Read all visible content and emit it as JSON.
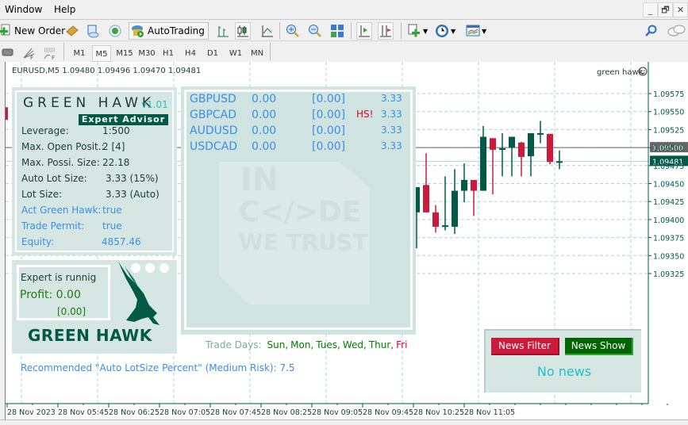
{
  "menu": {
    "items": [
      "Window",
      "Help"
    ]
  },
  "window_controls": {
    "minimize": "_",
    "restore": "🗗",
    "close": "✕"
  },
  "toolbar": {
    "new_order_label": "New Order",
    "autotrading_label": "AutoTrading",
    "icons": [
      "new-order-icon",
      "metaeditor-icon",
      "market-watch-icon",
      "signals-icon",
      "autotrading-icon",
      "bar-chart-icon",
      "candlestick-icon",
      "line-chart-icon",
      "zoom-in-icon",
      "zoom-out-icon",
      "tile-windows-icon",
      "chart-shift-icon",
      "autoscroll-icon",
      "indicators-icon",
      "periods-icon",
      "templates-icon",
      "search-icon",
      "chat-icon"
    ]
  },
  "timeframes": {
    "items": [
      "M1",
      "M5",
      "M15",
      "M30",
      "H1",
      "H4",
      "D1",
      "W1",
      "MN"
    ],
    "active": "M5"
  },
  "chart": {
    "symbol_info": "EURUSD,M5  1.09480 1.09496 1.09470 1.09481",
    "ea_label": "green hawk",
    "price_ticks": [
      "1.09575",
      "1.09550",
      "1.09525",
      "1.09500",
      "1.09475",
      "1.09450",
      "1.09425",
      "1.09400",
      "1.09375",
      "1.09350",
      "1.09325"
    ],
    "level_line_label": "1.09500",
    "bid_label": "1.09481",
    "time_ticks": [
      "28 Nov 2023",
      "28 Nov 05:45",
      "28 Nov 06:25",
      "28 Nov 07:05",
      "28 Nov 07:45",
      "28 Nov 08:25",
      "28 Nov 09:05",
      "28 Nov 09:45",
      "28 Nov 10:25",
      "28 Nov 11:05"
    ],
    "colors": {
      "bull": "#005a46",
      "bear": "#cc1a3c",
      "grid": "#a9d6df",
      "axis": "#005a46"
    },
    "candles": [
      {
        "o": 1.0941,
        "h": 1.0943,
        "l": 1.0936,
        "c": 1.09445
      },
      {
        "o": 1.09448,
        "h": 1.09492,
        "l": 1.09412,
        "c": 1.0941
      },
      {
        "o": 1.0941,
        "h": 1.0942,
        "l": 1.09382,
        "c": 1.0939
      },
      {
        "o": 1.0939,
        "h": 1.0946,
        "l": 1.09385,
        "c": 1.09392
      },
      {
        "o": 1.0939,
        "h": 1.0947,
        "l": 1.0938,
        "c": 1.0944
      },
      {
        "o": 1.0944,
        "h": 1.09478,
        "l": 1.09424,
        "c": 1.09455
      },
      {
        "o": 1.09455,
        "h": 1.09455,
        "l": 1.09405,
        "c": 1.0944
      },
      {
        "o": 1.0944,
        "h": 1.0953,
        "l": 1.0944,
        "c": 1.09515
      },
      {
        "o": 1.09513,
        "h": 1.0951,
        "l": 1.09435,
        "c": 1.09497
      },
      {
        "o": 1.09497,
        "h": 1.0952,
        "l": 1.0946,
        "c": 1.09499
      },
      {
        "o": 1.095,
        "h": 1.09508,
        "l": 1.0946,
        "c": 1.09515
      },
      {
        "o": 1.09507,
        "h": 1.09508,
        "l": 1.0946,
        "c": 1.09487
      },
      {
        "o": 1.09488,
        "h": 1.09508,
        "l": 1.0946,
        "c": 1.0952
      },
      {
        "o": 1.09519,
        "h": 1.09537,
        "l": 1.09506,
        "c": 1.0952
      },
      {
        "o": 1.09519,
        "h": 1.09519,
        "l": 1.09477,
        "c": 1.0948
      },
      {
        "o": 1.09481,
        "h": 1.09496,
        "l": 1.0947,
        "c": 1.09481
      }
    ]
  },
  "info_panel": {
    "title": "GREEN HAWK",
    "version": "v1.01",
    "subtitle": "Expert Advisor",
    "rows": [
      {
        "label": "Leverage:",
        "value": "1:500",
        "color": "#1f3a33"
      },
      {
        "label": "Max. Open Posit.:",
        "value": "2 [4]",
        "color": "#1f3a33"
      },
      {
        "label": "Max. Possi. Size:",
        "value": "22.18",
        "color": "#1f3a33"
      },
      {
        "label": "Auto Lot Size:",
        "value": "3.33 (15%)",
        "color": "#1f3a33"
      },
      {
        "label": "Lot Size:",
        "value": "3.33 (Auto)",
        "color": "#1f3a33"
      },
      {
        "label": "Act Green Hawk:",
        "value": "true",
        "color": "#3b8ee8"
      },
      {
        "label": "Trade Permit:",
        "value": "true",
        "color": "#3b8ee8"
      },
      {
        "label": "Equity:",
        "value": "4857.46",
        "color": "#3b8ee8"
      }
    ]
  },
  "status_panel": {
    "running_text": "Expert is runnig",
    "profit_text": "Profit: 0.00",
    "profit_sub": "[0.00]",
    "logo_text": "GREEN HAWK"
  },
  "pairs_panel": {
    "rows": [
      {
        "symbol": "GBPUSD",
        "profit": "0.00",
        "bracket": "[0.00]",
        "flag": "",
        "lot": "3.33"
      },
      {
        "symbol": "GBPCAD",
        "profit": "0.00",
        "bracket": "[0.00]",
        "flag": "HS!",
        "lot": "3.33"
      },
      {
        "symbol": "AUDUSD",
        "profit": "0.00",
        "bracket": "[0.00]",
        "flag": "",
        "lot": "3.33"
      },
      {
        "symbol": "USDCAD",
        "profit": "0.00",
        "bracket": "[0.00]",
        "flag": "",
        "lot": "3.33"
      }
    ],
    "watermark": [
      "IN",
      "C</>DE",
      "WE TRUST"
    ]
  },
  "trade_days": {
    "label": "Trade Days:",
    "days": [
      {
        "name": "Sun,",
        "color": "#008000"
      },
      {
        "name": "Mon,",
        "color": "#008000"
      },
      {
        "name": "Tues,",
        "color": "#008000"
      },
      {
        "name": "Wed,",
        "color": "#008000"
      },
      {
        "name": "Thur,",
        "color": "#008000"
      },
      {
        "name": "Fri",
        "color": "#e0002a"
      }
    ]
  },
  "recommendation": "Recommended \"Auto LotSize Percent\" (Medium Risk): 7.5",
  "news_panel": {
    "filter_label": "News Filter",
    "show_label": "News Show",
    "status": "No news"
  }
}
